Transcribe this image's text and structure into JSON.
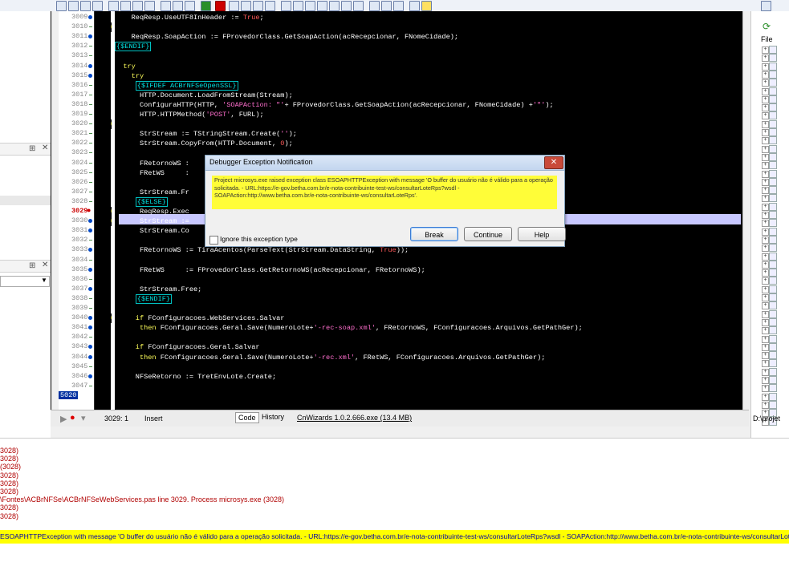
{
  "editor": {
    "lines": [
      {
        "num": "3009",
        "dot": true,
        "mark": "",
        "text": "    ReqResp.UseUTF8InHeader := True;"
      },
      {
        "num": "3010",
        "dot": false,
        "mark": "3010",
        "text": ""
      },
      {
        "num": "3011",
        "dot": true,
        "mark": "",
        "text": "    ReqResp.SoapAction := FProvedorClass.GetSoapAction(acRecepcionar, FNomeCidade);"
      },
      {
        "num": "3012",
        "dot": false,
        "mark": "",
        "text": "{$ENDIF}"
      },
      {
        "num": "3013",
        "dot": false,
        "mark": "",
        "text": ""
      },
      {
        "num": "3014",
        "dot": true,
        "mark": "",
        "text": "  try"
      },
      {
        "num": "3015",
        "dot": true,
        "mark": "",
        "text": "    try"
      },
      {
        "num": "3016",
        "dot": false,
        "mark": "",
        "text": "     {$IFDEF ACBrNFSeOpenSSL}"
      },
      {
        "num": "3017",
        "dot": false,
        "mark": "",
        "text": "      HTTP.Document.LoadFromStream(Stream);"
      },
      {
        "num": "3018",
        "dot": false,
        "mark": "",
        "text": "      ConfiguraHTTP(HTTP, 'SOAPAction: \"'+ FProvedorClass.GetSoapAction(acRecepcionar, FNomeCidade) +'\"');"
      },
      {
        "num": "3019",
        "dot": false,
        "mark": "",
        "text": "      HTTP.HTTPMethod('POST', FURL);"
      },
      {
        "num": "3020",
        "dot": false,
        "mark": "3020",
        "text": ""
      },
      {
        "num": "3021",
        "dot": false,
        "mark": "",
        "text": "      StrStream := TStringStream.Create('');"
      },
      {
        "num": "3022",
        "dot": false,
        "mark": "",
        "text": "      StrStream.CopyFrom(HTTP.Document, 0);"
      },
      {
        "num": "3023",
        "dot": false,
        "mark": "",
        "text": ""
      },
      {
        "num": "3024",
        "dot": false,
        "mark": "",
        "text": "      FRetornoWS :"
      },
      {
        "num": "3025",
        "dot": false,
        "mark": "",
        "text": "      FRetWS     :"
      },
      {
        "num": "3026",
        "dot": false,
        "mark": "",
        "text": ""
      },
      {
        "num": "3027",
        "dot": false,
        "mark": "",
        "text": "      StrStream.Fr"
      },
      {
        "num": "3028",
        "dot": false,
        "mark": "",
        "text": "     {$ELSE}"
      },
      {
        "num": "3029",
        "dot": true,
        "mark": "3029",
        "text": "      ReqResp.Exec"
      },
      {
        "num": "3030",
        "dot": true,
        "mark": "3030",
        "text": "      StrStream :="
      },
      {
        "num": "3031",
        "dot": true,
        "mark": "",
        "text": "      StrStream.Co"
      },
      {
        "num": "3032",
        "dot": false,
        "mark": "",
        "text": ""
      },
      {
        "num": "3033",
        "dot": true,
        "mark": "",
        "text": "      FRetornoWS := TiraAcentos(ParseText(StrStream.DataString, True));"
      },
      {
        "num": "3034",
        "dot": false,
        "mark": "",
        "text": ""
      },
      {
        "num": "3035",
        "dot": true,
        "mark": "",
        "text": "      FRetWS     := FProvedorClass.GetRetornoWS(acRecepcionar, FRetornoWS);"
      },
      {
        "num": "3036",
        "dot": false,
        "mark": "",
        "text": ""
      },
      {
        "num": "3037",
        "dot": true,
        "mark": "",
        "text": "      StrStream.Free;"
      },
      {
        "num": "3038",
        "dot": false,
        "mark": "",
        "text": "     {$ENDIF}"
      },
      {
        "num": "3039",
        "dot": false,
        "mark": "",
        "text": ""
      },
      {
        "num": "3040",
        "dot": true,
        "mark": "3040",
        "text": "     if FConfiguracoes.WebServices.Salvar"
      },
      {
        "num": "3041",
        "dot": true,
        "mark": "",
        "text": "      then FConfiguracoes.Geral.Save(NumeroLote+'-rec-soap.xml', FRetornoWS, FConfiguracoes.Arquivos.GetPathGer);"
      },
      {
        "num": "3042",
        "dot": false,
        "mark": "",
        "text": ""
      },
      {
        "num": "3043",
        "dot": true,
        "mark": "",
        "text": "     if FConfiguracoes.Geral.Salvar"
      },
      {
        "num": "3044",
        "dot": true,
        "mark": "",
        "text": "      then FConfiguracoes.Geral.Save(NumeroLote+'-rec.xml', FRetWS, FConfiguracoes.Arquivos.GetPathGer);"
      },
      {
        "num": "3045",
        "dot": false,
        "mark": "",
        "text": ""
      },
      {
        "num": "3046",
        "dot": true,
        "mark": "",
        "text": "     NFSeRetorno := TretEnvLote.Create;"
      },
      {
        "num": "3047",
        "dot": false,
        "mark": "",
        "text": ""
      }
    ],
    "last_num": "5020",
    "current_line": "3029"
  },
  "status": {
    "position": "3029:  1",
    "mode": "Insert",
    "tab_code": "Code",
    "tab_history": "History",
    "cnwizards": "CnWizards 1.0.2.666.exe (13.4 MB)",
    "right_path": "D:\\projet"
  },
  "right_panel": {
    "file_label": "File"
  },
  "dialog": {
    "title": "Debugger Exception Notification",
    "message": "Project microsys.exe raised exception class ESOAPHTTPException with message 'O buffer do usuário não é válido para a operação solicitada. - URL:https://e-gov.betha.com.br/e-nota-contribuinte-test-ws/consultarLoteRps?wsdl - SOAPAction:http://www.betha.com.br/e-nota-contribuinte-ws/consultarLoteRps'.",
    "checkbox_label": "Ignore this exception type",
    "break_label": "Break",
    "continue_label": "Continue",
    "help_label": "Help",
    "close_glyph": "✕"
  },
  "messages": {
    "lines": [
      "3028)",
      "3028)",
      "(3028)",
      "3028)",
      "3028)",
      "3028)",
      "\\Fontes\\ACBrNFSe\\ACBrNFSeWebServices.pas line 3029. Process microsys.exe (3028)",
      "3028)",
      "3028)"
    ],
    "highlight": "ESOAPHTTPException with message 'O buffer do usuário não é válido para a operação solicitada. - URL:https://e-gov.betha.com.br/e-nota-contribuinte-test-ws/consultarLoteRps?wsdl - SOAPAction:http://www.betha.com.br/e-nota-contribuinte-ws/consultarLoteRps'. Proc"
  }
}
